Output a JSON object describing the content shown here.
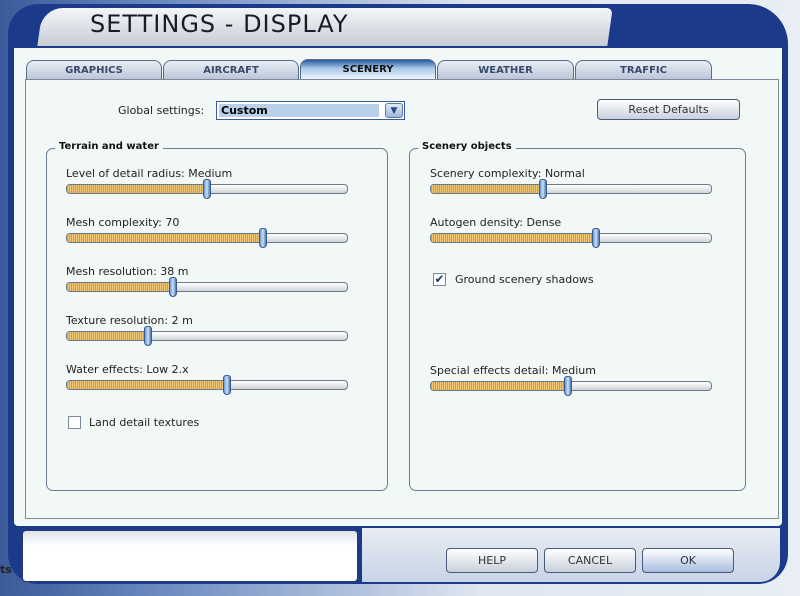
{
  "window": {
    "title": "SETTINGS - DISPLAY"
  },
  "tabs": [
    {
      "label": "GRAPHICS"
    },
    {
      "label": "AIRCRAFT"
    },
    {
      "label": "SCENERY",
      "active": true
    },
    {
      "label": "WEATHER"
    },
    {
      "label": "TRAFFIC"
    }
  ],
  "global": {
    "label": "Global settings:",
    "value": "Custom"
  },
  "reset_label": "Reset Defaults",
  "terrain": {
    "title": "Terrain and water",
    "sliders": [
      {
        "label": "Level of detail radius: Medium",
        "value": 0.5
      },
      {
        "label": "Mesh complexity: 70",
        "value": 0.7
      },
      {
        "label": "Mesh resolution: 38 m",
        "value": 0.38
      },
      {
        "label": "Texture resolution: 2 m",
        "value": 0.29
      },
      {
        "label": "Water effects: Low 2.x",
        "value": 0.57
      }
    ],
    "checkbox": {
      "label": "Land detail textures",
      "checked": false
    }
  },
  "scenery": {
    "title": "Scenery objects",
    "sliders": [
      {
        "label": "Scenery complexity: Normal",
        "value": 0.4
      },
      {
        "label": "Autogen density: Dense",
        "value": 0.59
      },
      {
        "label": "Special effects detail: Medium",
        "value": 0.49
      }
    ],
    "checkbox": {
      "label": "Ground scenery shadows",
      "checked": true
    }
  },
  "buttons": {
    "help": "HELP",
    "cancel": "CANCEL",
    "ok": "OK"
  },
  "bg_text": "ts"
}
